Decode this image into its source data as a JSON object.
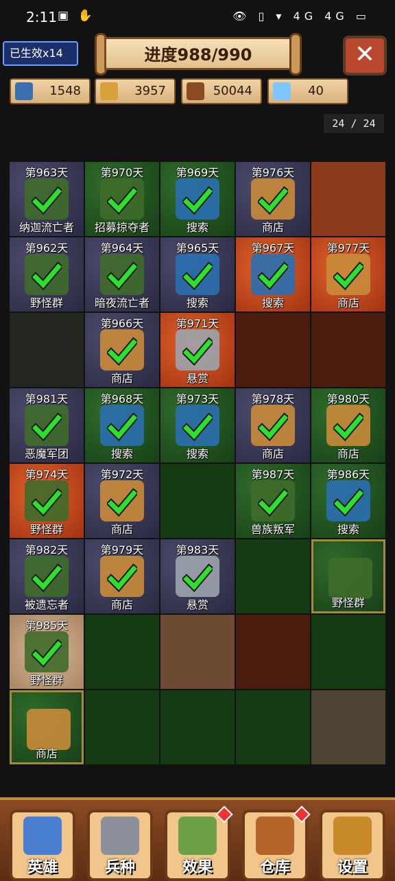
{
  "status_bar": {
    "time": "2:11",
    "left_icons": "▣ ✋",
    "right_icons": "👁 ▯ ▾ 4G 4G ▭"
  },
  "header": {
    "lives_label": "已生效x14",
    "progress_title": "进度988/990",
    "close_symbol": "✕"
  },
  "resources": [
    {
      "icon": "population-icon",
      "value": "1548",
      "color": "#3c6fb0"
    },
    {
      "icon": "gold-coins-icon",
      "value": "3957",
      "color": "#d9a13a"
    },
    {
      "icon": "wood-logs-icon",
      "value": "50044",
      "color": "#8a4a22"
    },
    {
      "icon": "crystal-wand-icon",
      "value": "40",
      "color": "#7fc7ff"
    }
  ],
  "page_indicator": "24 / 24",
  "grid": [
    [
      {
        "day": "第963天",
        "label": "纳迦流亡者",
        "tile": "stone",
        "done": true
      },
      {
        "day": "第970天",
        "label": "招募掠夺者",
        "tile": "grass",
        "done": true
      },
      {
        "day": "第969天",
        "label": "搜索",
        "tile": "grass",
        "done": true
      },
      {
        "day": "第976天",
        "label": "商店",
        "tile": "stone",
        "done": true
      },
      {
        "day": "",
        "label": "",
        "tile": "dirt",
        "done": false
      }
    ],
    [
      {
        "day": "第962天",
        "label": "野怪群",
        "tile": "stone",
        "done": true
      },
      {
        "day": "第964天",
        "label": "暗夜流亡者",
        "tile": "stone",
        "done": true
      },
      {
        "day": "第965天",
        "label": "搜索",
        "tile": "stone",
        "done": true
      },
      {
        "day": "第967天",
        "label": "搜索",
        "tile": "lava",
        "done": true
      },
      {
        "day": "第977天",
        "label": "商店",
        "tile": "lava",
        "done": true
      }
    ],
    [
      {
        "day": "",
        "label": "",
        "tile": "dark",
        "done": false
      },
      {
        "day": "第966天",
        "label": "商店",
        "tile": "stone",
        "done": true
      },
      {
        "day": "第971天",
        "label": "悬赏",
        "tile": "lava",
        "done": true
      },
      {
        "day": "",
        "label": "",
        "tile": "darkdirt",
        "done": false
      },
      {
        "day": "",
        "label": "",
        "tile": "darkdirt",
        "done": false
      }
    ],
    [
      {
        "day": "第981天",
        "label": "恶魔军团",
        "tile": "stone",
        "done": true
      },
      {
        "day": "第968天",
        "label": "搜索",
        "tile": "grass",
        "done": true
      },
      {
        "day": "第973天",
        "label": "搜索",
        "tile": "grass",
        "done": true
      },
      {
        "day": "第978天",
        "label": "商店",
        "tile": "stone",
        "done": true
      },
      {
        "day": "第980天",
        "label": "商店",
        "tile": "grass",
        "done": true
      }
    ],
    [
      {
        "day": "第974天",
        "label": "野怪群",
        "tile": "lava",
        "done": true
      },
      {
        "day": "第972天",
        "label": "商店",
        "tile": "stone",
        "done": true
      },
      {
        "day": "",
        "label": "",
        "tile": "darkgrass",
        "done": false
      },
      {
        "day": "第987天",
        "label": "兽族叛军",
        "tile": "grass",
        "done": true
      },
      {
        "day": "第986天",
        "label": "搜索",
        "tile": "grass",
        "done": true
      }
    ],
    [
      {
        "day": "第982天",
        "label": "被遗忘者",
        "tile": "stone",
        "done": true
      },
      {
        "day": "第979天",
        "label": "商店",
        "tile": "stone",
        "done": true
      },
      {
        "day": "第983天",
        "label": "悬赏",
        "tile": "stone",
        "done": true
      },
      {
        "day": "",
        "label": "",
        "tile": "darkgrass",
        "done": false
      },
      {
        "day": "",
        "label": "野怪群",
        "tile": "grass",
        "done": false,
        "highlight": true
      }
    ],
    [
      {
        "day": "第985天",
        "label": "野怪群",
        "tile": "sand",
        "done": true
      },
      {
        "day": "",
        "label": "",
        "tile": "darkgrass",
        "done": false
      },
      {
        "day": "",
        "label": "",
        "tile": "darksand",
        "done": false
      },
      {
        "day": "",
        "label": "",
        "tile": "darkdirt",
        "done": false
      },
      {
        "day": "",
        "label": "",
        "tile": "darkgrass",
        "done": false
      }
    ],
    [
      {
        "day": "",
        "label": "商店",
        "tile": "grass",
        "done": false,
        "highlight": true
      },
      {
        "day": "",
        "label": "",
        "tile": "darkgrass",
        "done": false
      },
      {
        "day": "",
        "label": "",
        "tile": "darkgrass",
        "done": false
      },
      {
        "day": "",
        "label": "",
        "tile": "darkgrass",
        "done": false
      },
      {
        "day": "",
        "label": "",
        "tile": "rock",
        "done": false
      }
    ]
  ],
  "nav": [
    {
      "label": "英雄",
      "icon": "sword-icon",
      "color": "#4a7ed0",
      "badge": false
    },
    {
      "label": "兵种",
      "icon": "helmet-icon",
      "color": "#8a8f99",
      "badge": false
    },
    {
      "label": "效果",
      "icon": "spellbook-icon",
      "color": "#6ea04a",
      "badge": true
    },
    {
      "label": "仓库",
      "icon": "treasure-chest-icon",
      "color": "#b5652a",
      "badge": true
    },
    {
      "label": "设置",
      "icon": "gear-icon",
      "color": "#c98b2a",
      "badge": false
    }
  ]
}
